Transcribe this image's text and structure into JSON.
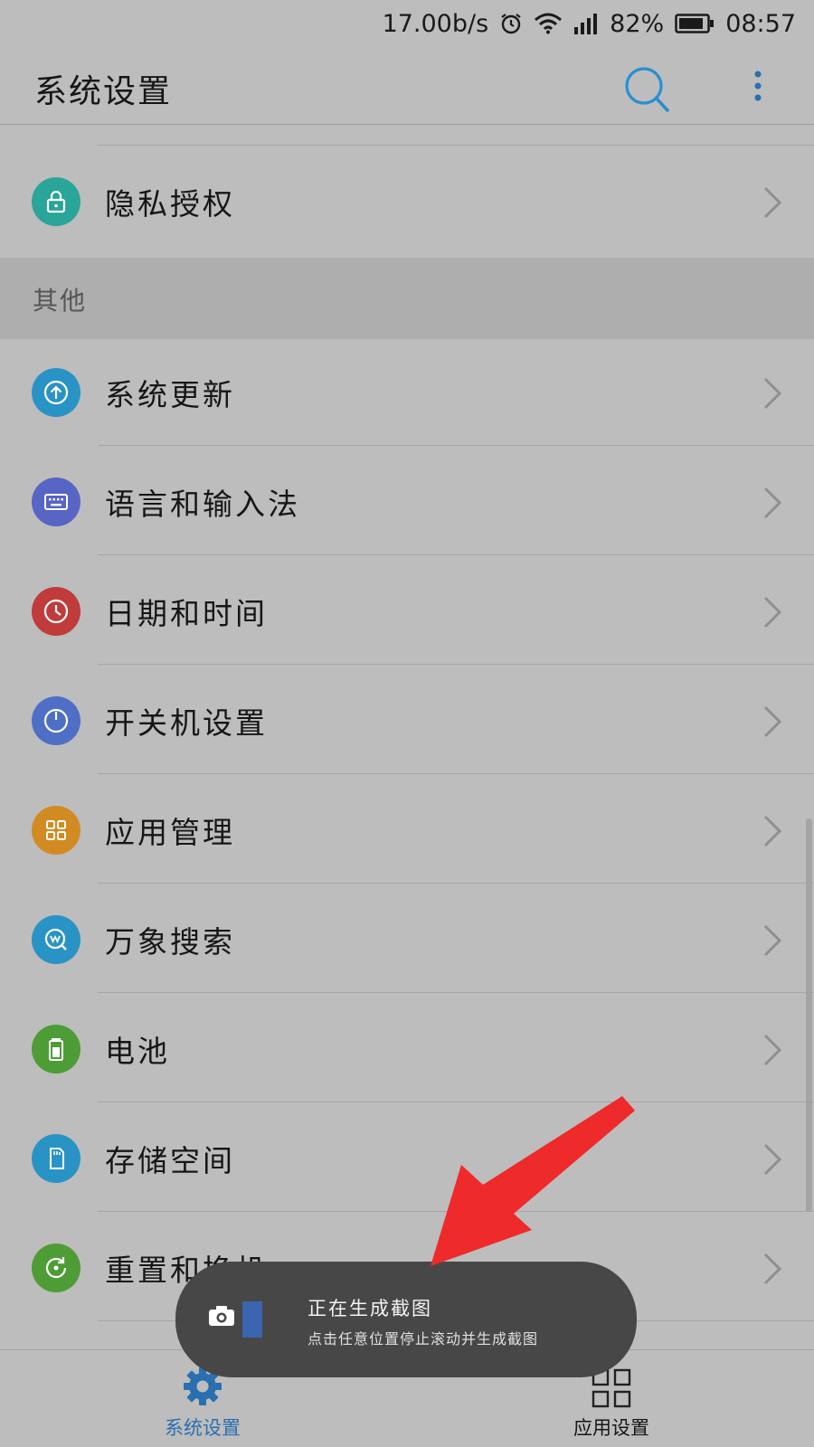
{
  "status_bar": {
    "speed": "17.00b/s",
    "battery": "82%",
    "time": "08:57"
  },
  "app_bar": {
    "title": "系统设置"
  },
  "privacy": {
    "label": "隐私授权",
    "color": "#2aa59a"
  },
  "section": {
    "title": "其他"
  },
  "items": [
    {
      "label": "系统更新",
      "icon": "arrow-up-circle-icon",
      "color": "#2a93c6"
    },
    {
      "label": "语言和输入法",
      "icon": "keyboard-icon",
      "color": "#5865c4"
    },
    {
      "label": "日期和时间",
      "icon": "clock-icon",
      "color": "#c03b3b"
    },
    {
      "label": "开关机设置",
      "icon": "power-icon",
      "color": "#4f6ec6"
    },
    {
      "label": "应用管理",
      "icon": "apps-grid-icon",
      "color": "#d28b22"
    },
    {
      "label": "万象搜索",
      "icon": "search-w-icon",
      "color": "#2a93c6"
    },
    {
      "label": "电池",
      "icon": "battery-icon",
      "color": "#4e9c36"
    },
    {
      "label": "存储空间",
      "icon": "sd-card-icon",
      "color": "#2a93c6"
    },
    {
      "label": "重置和换机",
      "icon": "reset-icon",
      "color": "#4e9c36"
    }
  ],
  "bottom_nav": {
    "system": {
      "label": "系统设置",
      "color": "#2a6fb0"
    },
    "apps": {
      "label": "应用设置"
    }
  },
  "toast": {
    "title": "正在生成截图",
    "subtitle": "点击任意位置停止滚动并生成截图"
  }
}
